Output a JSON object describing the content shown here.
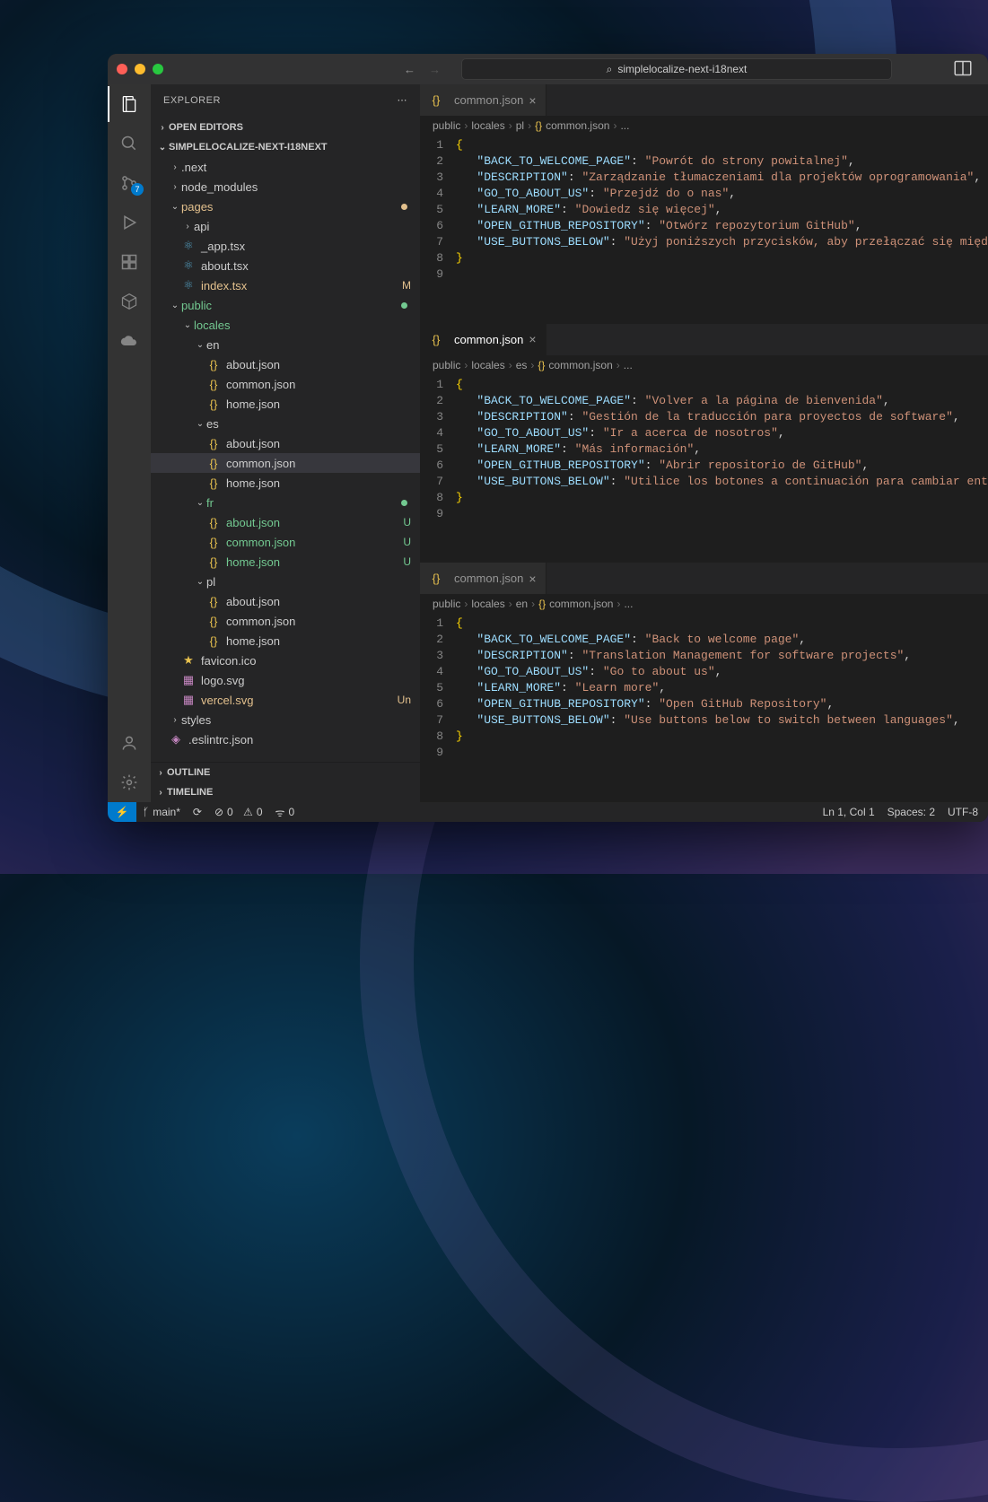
{
  "titlebar": {
    "search_icon": "🔍",
    "search_text": "simplelocalize-next-i18next"
  },
  "activity": {
    "scm_badge": "7"
  },
  "sidebar": {
    "title": "EXPLORER",
    "open_editors": "OPEN EDITORS",
    "project": "SIMPLELOCALIZE-NEXT-I18NEXT",
    "outline": "OUTLINE",
    "timeline": "TIMELINE",
    "tree": {
      "next": ".next",
      "node_modules": "node_modules",
      "pages": "pages",
      "api": "api",
      "app_tsx": "_app.tsx",
      "about_tsx": "about.tsx",
      "index_tsx": "index.tsx",
      "index_status": "M",
      "public": "public",
      "locales": "locales",
      "en": "en",
      "about_json": "about.json",
      "common_json": "common.json",
      "home_json": "home.json",
      "es": "es",
      "fr": "fr",
      "fr_status": "U",
      "pl": "pl",
      "favicon": "favicon.ico",
      "logo": "logo.svg",
      "vercel": "vercel.svg",
      "vercel_status": "Un",
      "styles": "styles",
      "eslintrc": ".eslintrc.json"
    }
  },
  "editors_common": {
    "tab_label": "common.json",
    "bc_public": "public",
    "bc_locales": "locales",
    "bc_file": "common.json",
    "bc_ellipsis": "..."
  },
  "panes": [
    {
      "lang": "pl",
      "lines": [
        {
          "key": "BACK_TO_WELCOME_PAGE",
          "val": "Powrót do strony powitalnej"
        },
        {
          "key": "DESCRIPTION",
          "val": "Zarządzanie tłumaczeniami dla projektów oprogramowania"
        },
        {
          "key": "GO_TO_ABOUT_US",
          "val": "Przejdź do o nas"
        },
        {
          "key": "LEARN_MORE",
          "val": "Dowiedz się więcej"
        },
        {
          "key": "OPEN_GITHUB_REPOSITORY",
          "val": "Otwórz repozytorium GitHub"
        },
        {
          "key": "USE_BUTTONS_BELOW",
          "val": "Użyj poniższych przycisków, aby przełączać się między "
        }
      ]
    },
    {
      "lang": "es",
      "lines": [
        {
          "key": "BACK_TO_WELCOME_PAGE",
          "val": "Volver a la página de bienvenida"
        },
        {
          "key": "DESCRIPTION",
          "val": "Gestión de la traducción para proyectos de software"
        },
        {
          "key": "GO_TO_ABOUT_US",
          "val": "Ir a acerca de nosotros"
        },
        {
          "key": "LEARN_MORE",
          "val": "Más información"
        },
        {
          "key": "OPEN_GITHUB_REPOSITORY",
          "val": "Abrir repositorio de GitHub"
        },
        {
          "key": "USE_BUTTONS_BELOW",
          "val": "Utilice los botones a continuación para cambiar entre "
        }
      ]
    },
    {
      "lang": "en",
      "lines": [
        {
          "key": "BACK_TO_WELCOME_PAGE",
          "val": "Back to welcome page"
        },
        {
          "key": "DESCRIPTION",
          "val": "Translation Management for software projects"
        },
        {
          "key": "GO_TO_ABOUT_US",
          "val": "Go to about us"
        },
        {
          "key": "LEARN_MORE",
          "val": "Learn more"
        },
        {
          "key": "OPEN_GITHUB_REPOSITORY",
          "val": "Open GitHub Repository"
        },
        {
          "key": "USE_BUTTONS_BELOW",
          "val": "Use buttons below to switch between languages"
        }
      ]
    }
  ],
  "statusbar": {
    "branch": "main*",
    "sync": "⟳",
    "errors": "0",
    "warnings": "0",
    "port": "0",
    "ln_col": "Ln 1, Col 1",
    "spaces": "Spaces: 2",
    "encoding": "UTF-8"
  }
}
